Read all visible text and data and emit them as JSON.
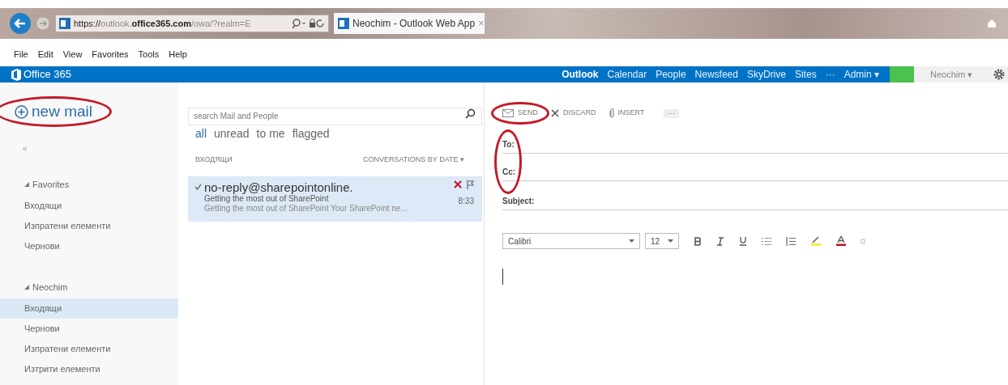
{
  "browser": {
    "address": {
      "prefix": "https://",
      "dim1": "outlook.",
      "host": "office365.com",
      "rest": "/owa/?realm=E"
    },
    "tab": {
      "title": "Neochim - Outlook Web App",
      "close": "×"
    },
    "menu": [
      "File",
      "Edit",
      "View",
      "Favorites",
      "Tools",
      "Help"
    ]
  },
  "suite_bar": {
    "brand": "Office 365",
    "nav": [
      {
        "label": "Outlook",
        "selected": true
      },
      {
        "label": "Calendar",
        "selected": false
      },
      {
        "label": "People",
        "selected": false
      },
      {
        "label": "Newsfeed",
        "selected": false
      },
      {
        "label": "SkyDrive",
        "selected": false
      },
      {
        "label": "Sites",
        "selected": false
      },
      {
        "label": "···",
        "selected": false
      },
      {
        "label": "Admin ▾",
        "selected": false
      }
    ],
    "user": "Neochim ▾"
  },
  "new_mail": "new mail",
  "collapse": "«",
  "folders": [
    {
      "label": "Favorites",
      "expanded": true,
      "selected": false,
      "children": [
        {
          "label": "Входящи",
          "selected": false
        },
        {
          "label": "Изпратени елементи",
          "selected": false
        },
        {
          "label": "Чернови",
          "selected": false
        }
      ]
    },
    {
      "label": "Neochim",
      "expanded": true,
      "selected": false,
      "children": [
        {
          "label": "Входящи",
          "selected": true
        },
        {
          "label": "Чернови",
          "selected": false
        },
        {
          "label": "Изпратени елементи",
          "selected": false
        },
        {
          "label": "Изтрити елементи",
          "selected": false
        }
      ]
    }
  ],
  "search": {
    "placeholder": "search Mail and People"
  },
  "filters": [
    {
      "label": "all",
      "selected": true
    },
    {
      "label": "unread",
      "selected": false
    },
    {
      "label": "to me",
      "selected": false
    },
    {
      "label": "flagged",
      "selected": false
    }
  ],
  "list_header": {
    "folder": "ВХОДЯЩИ",
    "sort": "CONVERSATIONS BY DATE ▾"
  },
  "messages": [
    {
      "sender": "no-reply@sharepointonline.",
      "subject": "Getting the most out of SharePoint",
      "preview": "Getting the most out of SharePoint Your SharePoint ne...",
      "time": "8:33",
      "selected": true,
      "read": true
    }
  ],
  "compose": {
    "actions": [
      {
        "kind": "send",
        "label": "SEND"
      },
      {
        "kind": "discard",
        "label": "DISCARD"
      },
      {
        "kind": "insert",
        "label": "INSERT"
      },
      {
        "kind": "more",
        "label": "···"
      }
    ],
    "fields": [
      "To:",
      "Cc:",
      "Subject:"
    ],
    "font": "Calibri",
    "size": "12"
  }
}
